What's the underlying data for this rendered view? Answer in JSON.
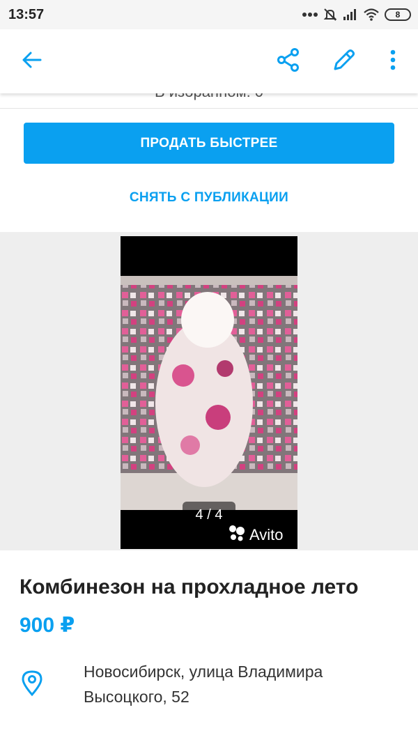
{
  "status_bar": {
    "time": "13:57",
    "battery": "8"
  },
  "toolbar": {
    "back_icon": "arrow-left-icon",
    "share_icon": "share-icon",
    "edit_icon": "pencil-icon",
    "more_icon": "more-vertical-icon"
  },
  "peek_text": "В избранном: 0",
  "actions": {
    "sell_faster": "ПРОДАТЬ БЫСТРЕЕ",
    "unpublish": "СНЯТЬ С ПУБЛИКАЦИИ"
  },
  "gallery": {
    "counter": "4 / 4",
    "watermark": "Avito"
  },
  "listing": {
    "title": "Комбинезон на прохладное лето",
    "price": "900 ₽",
    "address_line1": "Новосибирск, улица Владимира",
    "address_line2": "Высоцкого, 52"
  },
  "colors": {
    "accent": "#0aa0f0"
  }
}
